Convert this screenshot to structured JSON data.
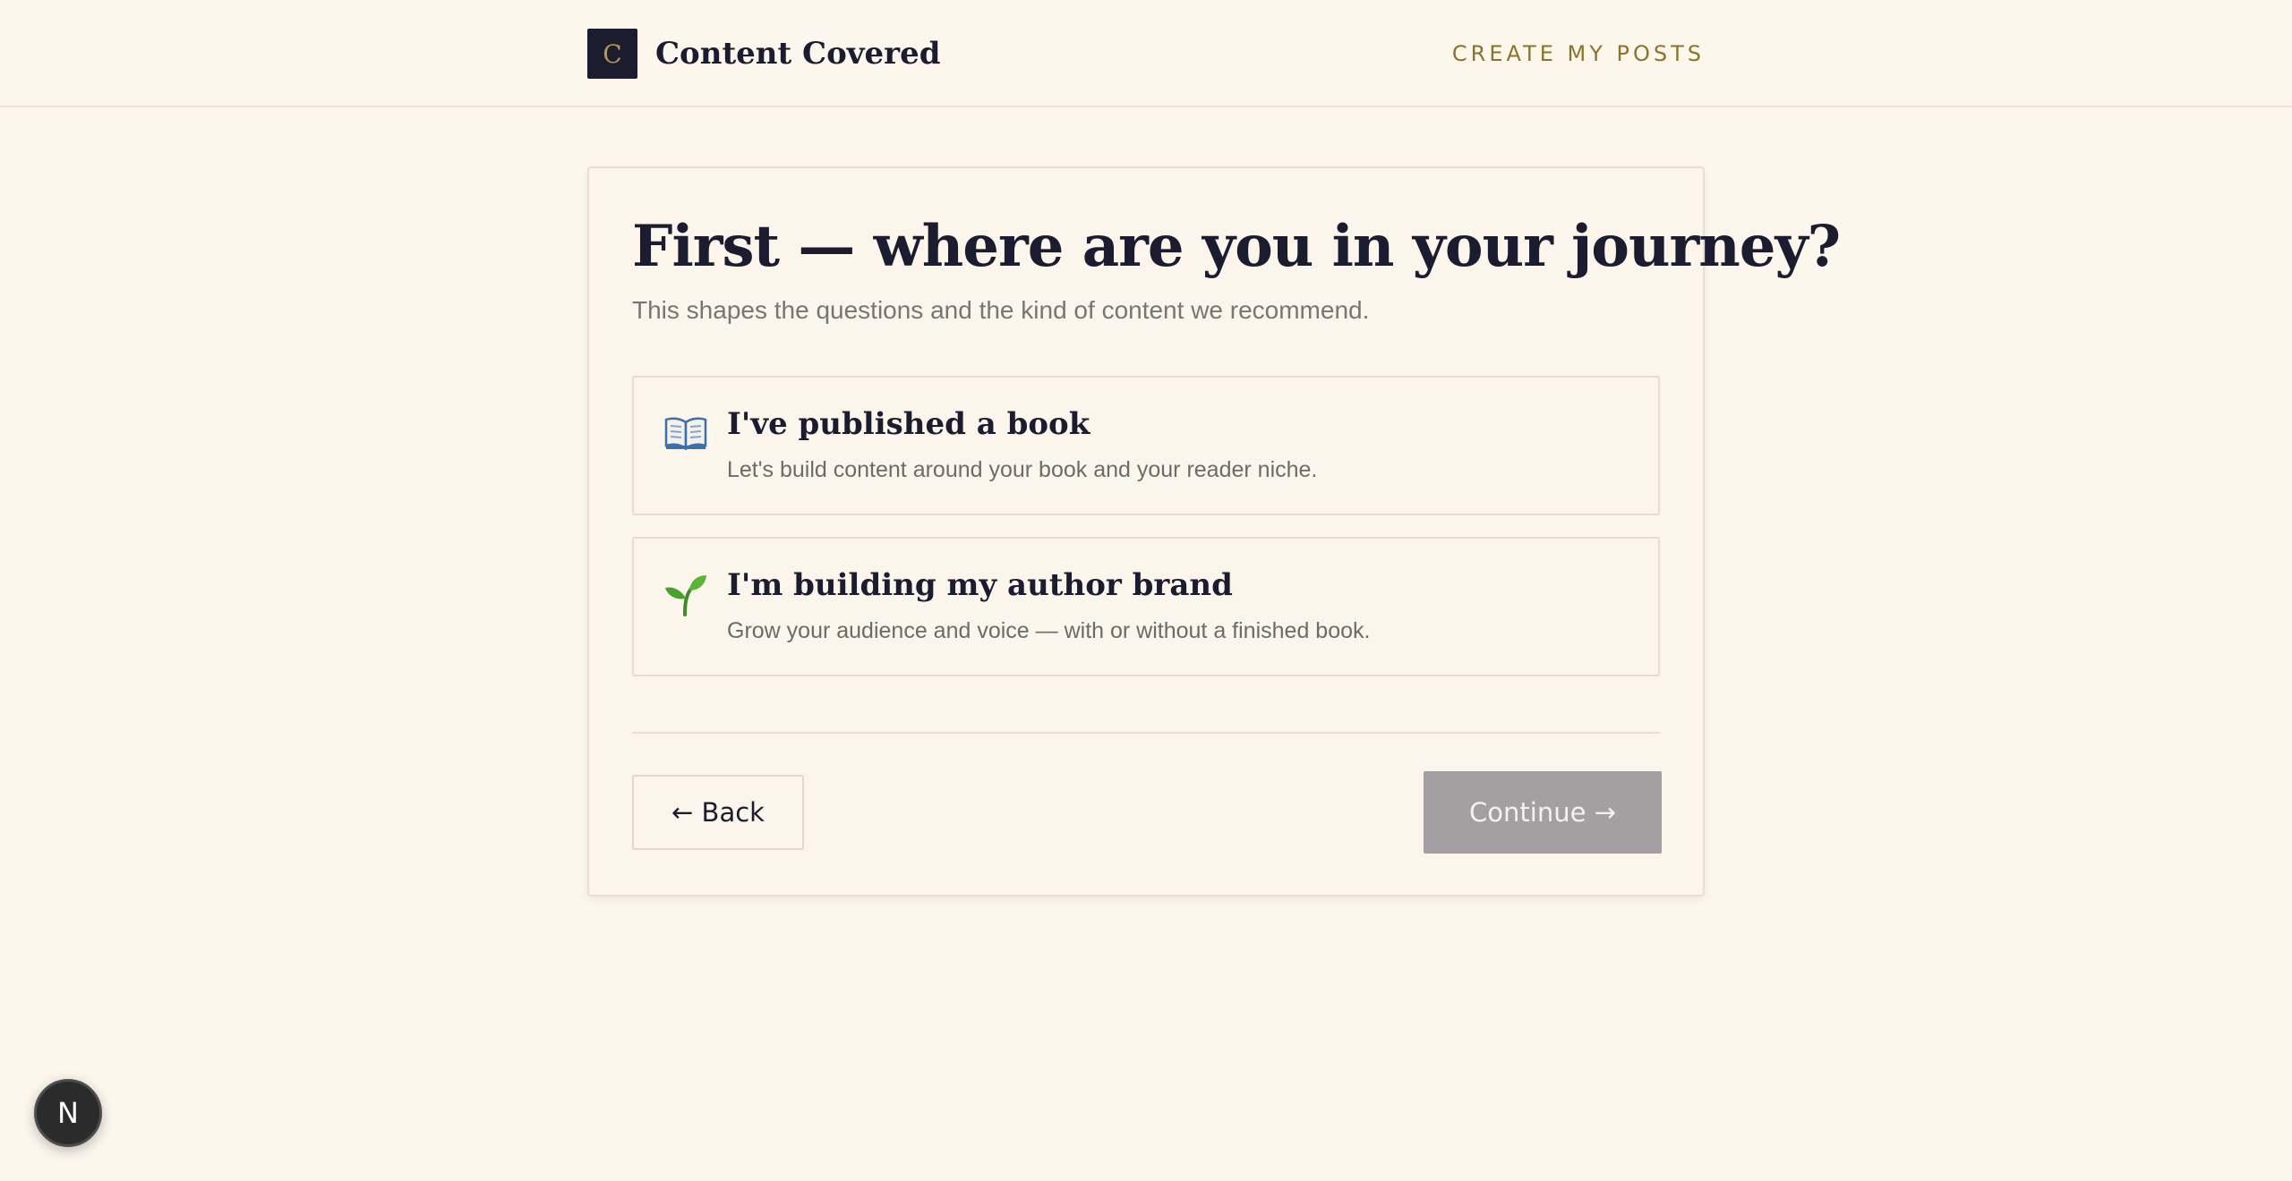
{
  "header": {
    "logo_letter": "C",
    "brand_name": "Content Covered",
    "nav_link": "CREATE MY POSTS"
  },
  "card": {
    "title": "First — where are you in your journey?",
    "subtitle": "This shapes the questions and the kind of content we recommend.",
    "options": [
      {
        "icon": "open-book-icon",
        "title": "I've published a book",
        "description": "Let's build content around your book and your reader niche."
      },
      {
        "icon": "seedling-icon",
        "title": "I'm building my author brand",
        "description": "Grow your audience and voice — with or without a finished book."
      }
    ],
    "back_label": "← Back",
    "continue_label": "Continue →"
  },
  "dev_badge": {
    "letter": "N"
  },
  "colors": {
    "background": "#fcf6ec",
    "navy": "#1c1c30",
    "gold": "#8b7428",
    "disabled_button": "#a4a0a2"
  }
}
